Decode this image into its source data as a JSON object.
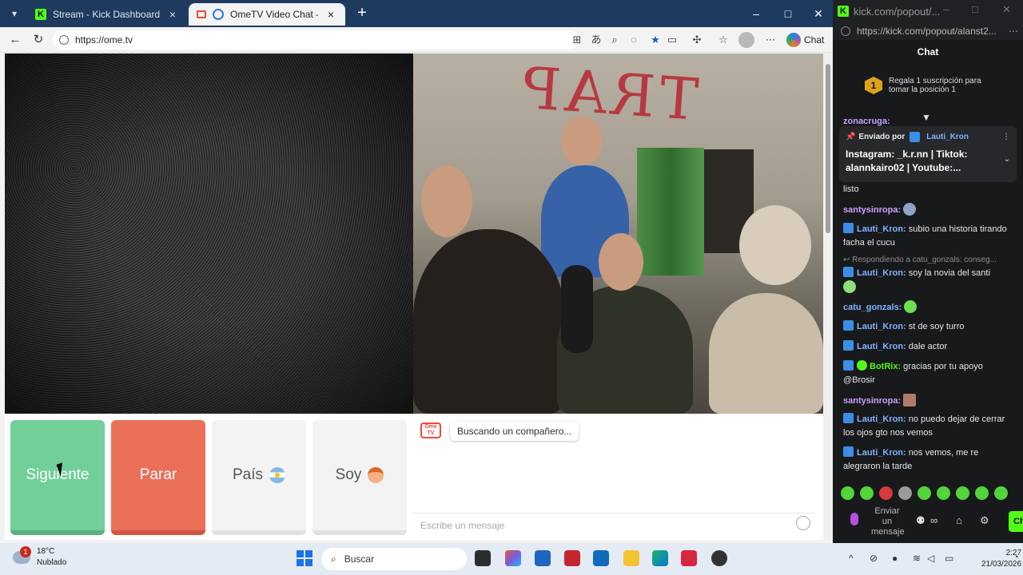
{
  "browser": {
    "tabs": [
      {
        "title": "Stream - Kick Dashboard"
      },
      {
        "title": "OmeTV Video Chat — Omegle"
      }
    ],
    "url": "https://ome.tv",
    "copilot_label": "Chat"
  },
  "ometv": {
    "partner_wall_text": "TRAP",
    "buttons": {
      "next": "Siguiente",
      "stop": "Parar",
      "country": "País",
      "gender": "Soy"
    },
    "logo_text": "Ome TV",
    "status": "Buscando un compañero...",
    "message_placeholder": "Escribe un mensaje"
  },
  "side_window": {
    "title": "kick.com/popout/...",
    "url": "https://kick.com/popout/alanst2...",
    "header": "Chat",
    "sub_badge": "1",
    "sub_promo": "Regala 1 suscripción para tomar la posición 1",
    "partial_user": "zonacruga:",
    "pinned": {
      "label": "Enviado por",
      "user": "Lauti_Kron",
      "text": "Instagram: _k.r.nn | Tiktok: alannkairo02 | Youtube:..."
    },
    "reply_context": "Respondiendo a catu_gonzals: conseg...",
    "messages": [
      {
        "user": "",
        "text": "listo"
      },
      {
        "user": "santysinropa:",
        "text": ""
      },
      {
        "user": "Lauti_Kron:",
        "text": "subio una historia tirando facha el cucu"
      },
      {
        "user": "Lauti_Kron:",
        "text": "soy la novia del santi"
      },
      {
        "user": "catu_gonzals:",
        "text": ""
      },
      {
        "user": "Lauti_Kron:",
        "text": "st de soy turro"
      },
      {
        "user": "Lauti_Kron:",
        "text": "dale actor"
      },
      {
        "user": "BotRix:",
        "text": "gracias por tu apoyo @Brosir"
      },
      {
        "user": "santysinropa:",
        "text": ""
      },
      {
        "user": "Lauti_Kron:",
        "text": "no puedo dejar de cerrar los ojos gto nos vemos"
      },
      {
        "user": "Lauti_Kron:",
        "text": "nos vemos, me re alegraron la tarde"
      }
    ],
    "send_label": "Enviar un mensaje",
    "send_button": "Ch"
  },
  "taskbar": {
    "weather_temp": "18°C",
    "weather_desc": "Nublado",
    "weather_badge": "1",
    "search_label": "Buscar",
    "time": "2:27",
    "date": "21/03/2026"
  }
}
